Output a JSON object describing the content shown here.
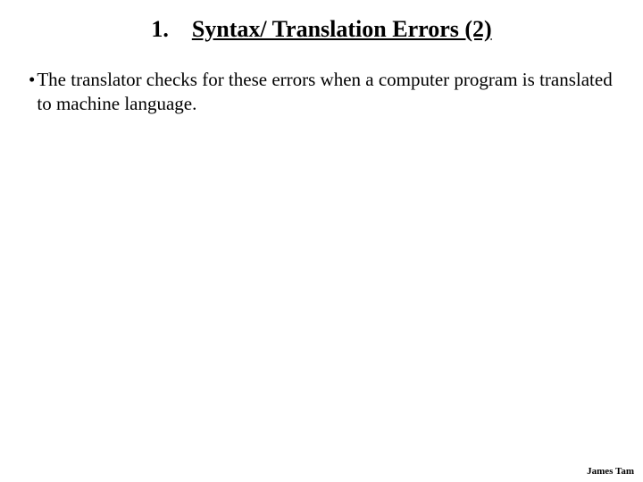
{
  "heading": {
    "number": "1.",
    "title": "Syntax/ Translation Errors (2)"
  },
  "bullets": [
    "The translator checks for these errors when a computer program is translated to machine language."
  ],
  "author": "James Tam"
}
